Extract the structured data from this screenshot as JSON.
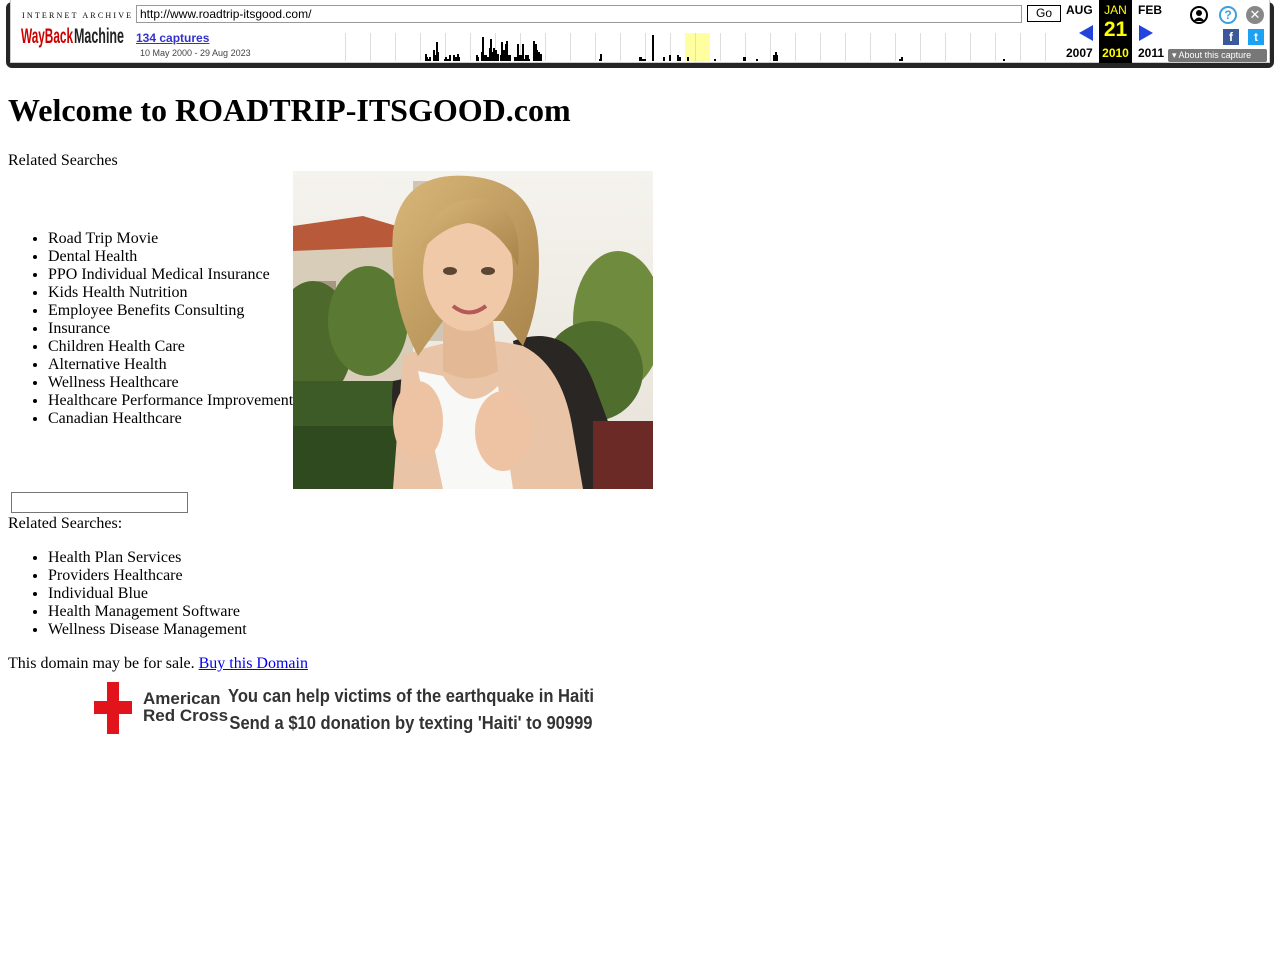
{
  "wayback": {
    "logo_top": "INTERNET ARCHIVE",
    "logo_main": "WayBackMachine",
    "url": "http://www.roadtrip-itsgood.com/",
    "go_label": "Go",
    "captures": "134 captures",
    "date_range": "10 May 2000 - 29 Aug 2023",
    "prev_month": "AUG",
    "prev_year": "2007",
    "current_month": "JAN",
    "current_day": "21",
    "current_year": "2010",
    "next_month": "FEB",
    "next_year": "2011",
    "about_label": "About this capture",
    "help_glyph": "?",
    "close_glyph": "✕",
    "facebook_glyph": "f",
    "twitter_glyph": "t",
    "accent_color": "#2244dd",
    "highlight_color": "#ffffa0",
    "sparkline": [
      0,
      0,
      0,
      0,
      0,
      0,
      0,
      0,
      0,
      0,
      0,
      0,
      0,
      0,
      0,
      0,
      0,
      0,
      0,
      0,
      0,
      0,
      0,
      0,
      0,
      0,
      0,
      0,
      0,
      0,
      0,
      0,
      0,
      0,
      0,
      0,
      0,
      0,
      0,
      0,
      0,
      0,
      0,
      0,
      0,
      0,
      0,
      0,
      0,
      0,
      0,
      0,
      0,
      0,
      0,
      0,
      4,
      2,
      1,
      2,
      0,
      6,
      3,
      10,
      5,
      0,
      0,
      0,
      1,
      2,
      1,
      3,
      0,
      0,
      3,
      2,
      4,
      2,
      0,
      0,
      0,
      0,
      0,
      0,
      0,
      0,
      0,
      0,
      3,
      2,
      0,
      5,
      13,
      3,
      3,
      2,
      7,
      12,
      5,
      7,
      6,
      4,
      0,
      3,
      10,
      6,
      9,
      11,
      3,
      3,
      0,
      0,
      2,
      2,
      9,
      3,
      3,
      9,
      1,
      3,
      3,
      1,
      0,
      0,
      11,
      9,
      6,
      5,
      4,
      0,
      0,
      0,
      0,
      0,
      0,
      0,
      0,
      0,
      0,
      0,
      0,
      0,
      0,
      0,
      0,
      0,
      0,
      0,
      0,
      0,
      0,
      0,
      0,
      0,
      0,
      0,
      0,
      0,
      0,
      0,
      0,
      0,
      0,
      0,
      0,
      1,
      4,
      0,
      0,
      0,
      0,
      0,
      0,
      0,
      0,
      0,
      0,
      0,
      0,
      0,
      0,
      0,
      0,
      0,
      0,
      0,
      0,
      0,
      0,
      0,
      2,
      2,
      1,
      1,
      0,
      0,
      0,
      0,
      14,
      0,
      0,
      0,
      0,
      0,
      0,
      2,
      0,
      0,
      0,
      3,
      0,
      0,
      0,
      0,
      3,
      2,
      0,
      0,
      0,
      0,
      2,
      0,
      0,
      0,
      0,
      0,
      0,
      0,
      0,
      0,
      0,
      0,
      0,
      0,
      0,
      0,
      0,
      1,
      0,
      0,
      0,
      0,
      0,
      0,
      0,
      0,
      0,
      0,
      0,
      0,
      0,
      0,
      0,
      0,
      0,
      2,
      2,
      0,
      0,
      0,
      0,
      0,
      0,
      1,
      0,
      0,
      0,
      0,
      0,
      0,
      0,
      0,
      0,
      0,
      3,
      5,
      3,
      0,
      0,
      0,
      0,
      0,
      0,
      0,
      0,
      0,
      0,
      0,
      0,
      0,
      0,
      0,
      0,
      0,
      0,
      0,
      0,
      0,
      0,
      0,
      0,
      0,
      0,
      0,
      0,
      0,
      0,
      0,
      0,
      0,
      0,
      0,
      0,
      0,
      0,
      0,
      0,
      0,
      0,
      0,
      0,
      0,
      0,
      0,
      0,
      0,
      0,
      0,
      0,
      0,
      0,
      0,
      0,
      0,
      0,
      0,
      0,
      0,
      0,
      0,
      0,
      0,
      0,
      0,
      0,
      0,
      0,
      0,
      0,
      0,
      0,
      0,
      0,
      1,
      2,
      0,
      0,
      0,
      0,
      0,
      0,
      0,
      0,
      0,
      0,
      0,
      0,
      0,
      0,
      0,
      0,
      0,
      0,
      0,
      0,
      0,
      0,
      0,
      0,
      0,
      0,
      0,
      0,
      0,
      0,
      0,
      0,
      0,
      0,
      0,
      0,
      0,
      0,
      0,
      0,
      0,
      0,
      0,
      0,
      0,
      0,
      0,
      0,
      0,
      0,
      0,
      0,
      0,
      0,
      0,
      0,
      0,
      0,
      0,
      0,
      0,
      0,
      0,
      1,
      0,
      0,
      0,
      0,
      0,
      0,
      0,
      0,
      0,
      0,
      0,
      0,
      0,
      0,
      0,
      0,
      0,
      0,
      0,
      0,
      0,
      0,
      0,
      0,
      0,
      0,
      0,
      0,
      0,
      0,
      0,
      0,
      0,
      0,
      0
    ]
  },
  "page": {
    "title": "Welcome to ROADTRIP-ITSGOOD.com",
    "related_heading_1": "Related Searches",
    "related_list_1": [
      "Road Trip Movie",
      "Dental Health",
      "PPO Individual Medical Insurance",
      "Kids Health Nutrition",
      "Employee Benefits Consulting",
      "Insurance",
      "Children Health Care",
      "Alternative Health",
      "Wellness Healthcare",
      "Healthcare Performance Improvement",
      "Canadian Healthcare"
    ],
    "search_value": "",
    "related_heading_2": "Related Searches:",
    "related_list_2": [
      "Health Plan Services",
      "Providers Healthcare",
      "Individual Blue",
      "Health Management Software",
      "Wellness Disease Management"
    ],
    "sale_text": "This domain may be for sale.",
    "sale_link": "Buy this Domain"
  },
  "banner": {
    "org_line_1": "American",
    "org_line_2": "Red Cross",
    "message_line_1": "You can help victims of the earthquake in Haiti",
    "message_line_2": "Send a $10 donation by texting 'Haiti' to 90999",
    "brand_color": "#e1141b"
  }
}
